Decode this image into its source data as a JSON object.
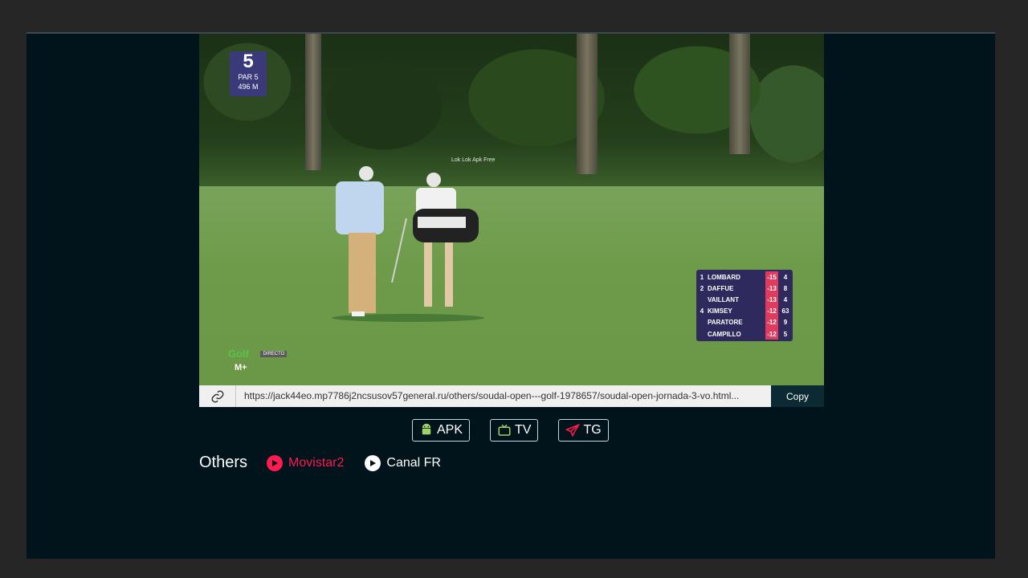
{
  "video": {
    "hole": {
      "number": "5",
      "par": "PAR 5",
      "distance": "496 M"
    },
    "watermark": "Lok Lok Apk Free",
    "leaderboard": [
      {
        "pos": "1",
        "name": "LOMBARD",
        "score": "-15",
        "thru": "4"
      },
      {
        "pos": "2",
        "name": "DAFFUE",
        "score": "-13",
        "thru": "8"
      },
      {
        "pos": "",
        "name": "VAILLANT",
        "score": "-13",
        "thru": "4"
      },
      {
        "pos": "4",
        "name": "KIMSEY",
        "score": "-12",
        "thru": "63"
      },
      {
        "pos": "",
        "name": "PARATORE",
        "score": "-12",
        "thru": "9"
      },
      {
        "pos": "",
        "name": "CAMPILLO",
        "score": "-12",
        "thru": "5"
      }
    ],
    "broadcaster": {
      "logo": "Golf",
      "live": "DIRECTO",
      "network": "M+"
    }
  },
  "urlbar": {
    "icon": "link-icon",
    "url": "https://jack44eo.mp7786j2ncsusov57general.ru/others/soudal-open---golf-1978657/soudal-open-jornada-3-vo.html...",
    "copy_label": "Copy"
  },
  "apps": [
    {
      "icon": "android-icon",
      "label": "APK"
    },
    {
      "icon": "tv-icon",
      "label": "TV"
    },
    {
      "icon": "telegram-icon",
      "label": "TG"
    }
  ],
  "others": {
    "title": "Others",
    "channels": [
      {
        "label": "Movistar2",
        "active": true,
        "color": "#ff1a4f"
      },
      {
        "label": "Canal FR",
        "active": false,
        "color": "#ffffff"
      }
    ]
  },
  "colors": {
    "background": "#262626",
    "panel": "#01131b",
    "accent": "#ff1a4f",
    "copy_button": "#0b2a33"
  }
}
